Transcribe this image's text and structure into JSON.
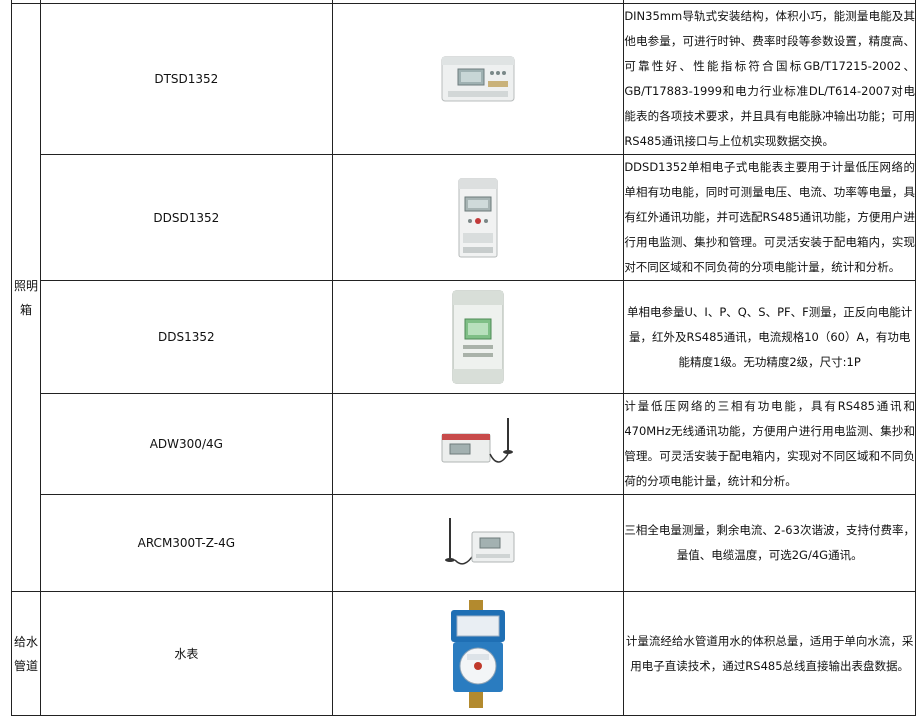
{
  "table": {
    "groups": [
      {
        "category": "照明箱",
        "rows": [
          {
            "model": "DTSD1352",
            "image_icon": "three-phase-din-meter-icon",
            "description": "DIN35mm导轨式安装结构，体积小巧，能测量电能及其他电参量，可进行时钟、费率时段等参数设置，精度高、可靠性好、性能指标符合国标GB/T17215-2002、GB/T17883-1999和电力行业标准DL/T614-2007对电能表的各项技术要求，并且具有电能脉冲输出功能；可用RS485通讯接口与上位机实现数据交换。"
          },
          {
            "model": "DDSD1352",
            "image_icon": "single-phase-din-meter-icon",
            "description": "DDSD1352单相电子式电能表主要用于计量低压网络的单相有功电能，同时可测量电压、电流、功率等电量，具有红外通讯功能，并可选配RS485通讯功能，方便用户进行用电监测、集抄和管理。可灵活安装于配电箱内，实现对不同区域和不同负荷的分项电能计量，统计和分析。"
          },
          {
            "model": "DDS1352",
            "image_icon": "compact-din-meter-icon",
            "description": "单相电参量U、I、P、Q、S、PF、F测量，正反向电能计量，红外及RS485通讯，电流规格10（60）A，有功电能精度1级。无功精度2级，尺寸:1P"
          },
          {
            "model": "ADW300/4G",
            "image_icon": "wireless-meter-with-antenna-icon",
            "description": "计量低压网络的三相有功电能，具有RS485通讯和470MHz无线通讯功能，方便用户进行用电监测、集抄和管理。可灵活安装于配电箱内，实现对不同区域和不同负荷的分项电能计量，统计和分析。"
          },
          {
            "model": "ARCM300T-Z-4G",
            "image_icon": "residual-current-meter-antenna-icon",
            "description": "三相全电量测量，剩余电流、2-63次谐波，支持付费率，量值、电缆温度，可选2G/4G通讯。"
          }
        ]
      },
      {
        "category": "给水管道",
        "rows": [
          {
            "model": "水表",
            "image_icon": "water-meter-icon",
            "description": "计量流经给水管道用水的体积总量，适用于单向水流，采用电子直读技术，通过RS485总线直接输出表盘数据。"
          }
        ]
      }
    ]
  }
}
